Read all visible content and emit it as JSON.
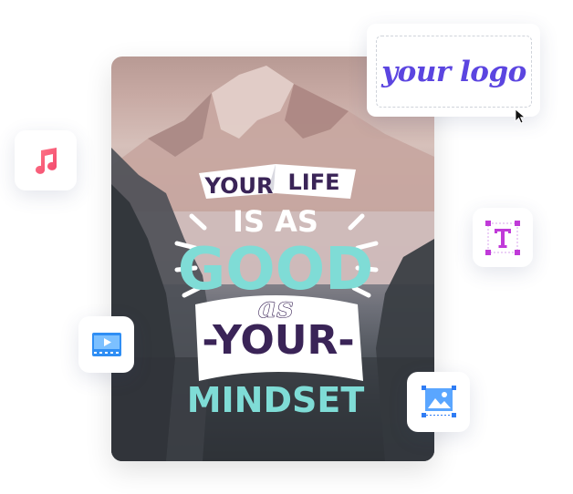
{
  "poster": {
    "line1_left": "YOUR",
    "line1_right": "LIFE",
    "line2": "IS AS",
    "line3": "GOOD",
    "line4": "as",
    "line5": "-YOUR-",
    "line6": "MINDSET"
  },
  "logo_card": {
    "text": "your logo"
  },
  "icons": {
    "music": "music-note-icon",
    "text": "text-box-icon",
    "video": "video-player-icon",
    "image": "image-resize-icon",
    "cursor": "mouse-cursor-icon"
  },
  "colors": {
    "logo_purple": "#5b45e0",
    "music_pink": "#f7567c",
    "text_magenta": "#c03ad8",
    "video_blue": "#2f8ef4",
    "image_blue": "#2f7cf4",
    "poster_teal": "#7fdcd6",
    "poster_purple": "#3a2457"
  }
}
